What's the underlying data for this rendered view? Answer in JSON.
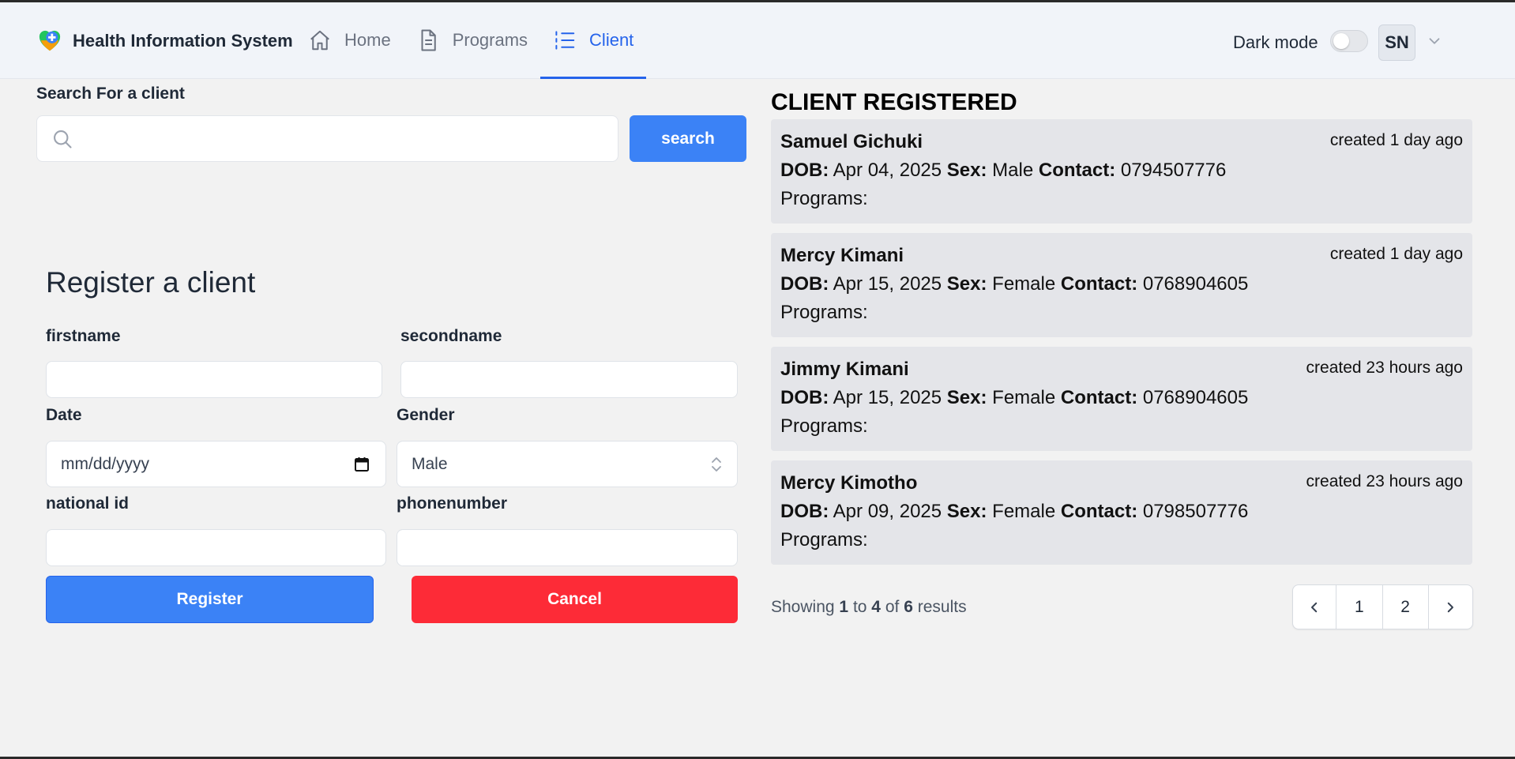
{
  "app": {
    "title": "Health Information System"
  },
  "nav": [
    {
      "label": "Home",
      "icon": "home-icon"
    },
    {
      "label": "Programs",
      "icon": "document-icon"
    },
    {
      "label": "Client",
      "icon": "list-icon",
      "active": true
    }
  ],
  "header": {
    "dark_mode_label": "Dark mode",
    "dark_mode_on": false,
    "avatar_initials": "SN"
  },
  "search": {
    "label": "Search For a client",
    "value": "",
    "button": "search"
  },
  "register": {
    "title": "Register a client",
    "firstname_label": "firstname",
    "secondname_label": "secondname",
    "date_label": "Date",
    "date_placeholder": "mm/dd/yyyy",
    "gender_label": "Gender",
    "gender_value": "Male",
    "nationalid_label": "national id",
    "phone_label": "phonenumber",
    "register_button": "Register",
    "cancel_button": "Cancel"
  },
  "clients": {
    "title": "CLIENT REGISTERED",
    "dob_label": "DOB:",
    "sex_label": "Sex:",
    "contact_label": "Contact:",
    "programs_label": "Programs:",
    "items": [
      {
        "name": "Samuel Gichuki",
        "created": "created 1 day ago",
        "dob": "Apr 04, 2025",
        "sex": "Male",
        "contact": "0794507776"
      },
      {
        "name": "Mercy Kimani",
        "created": "created 1 day ago",
        "dob": "Apr 15, 2025",
        "sex": "Female",
        "contact": "0768904605"
      },
      {
        "name": "Jimmy Kimani",
        "created": "created 23 hours ago",
        "dob": "Apr 15, 2025",
        "sex": "Female",
        "contact": "0768904605"
      },
      {
        "name": "Mercy Kimotho",
        "created": "created 23 hours ago",
        "dob": "Apr 09, 2025",
        "sex": "Female",
        "contact": "0798507776"
      }
    ]
  },
  "pagination": {
    "showing": "Showing",
    "from": "1",
    "to_word": "to",
    "to": "4",
    "of_word": "of",
    "total": "6",
    "results_word": "results",
    "pages": [
      "1",
      "2"
    ]
  },
  "colors": {
    "primary": "#3b82f6",
    "danger": "#fd2b37",
    "active_nav": "#2563eb"
  }
}
